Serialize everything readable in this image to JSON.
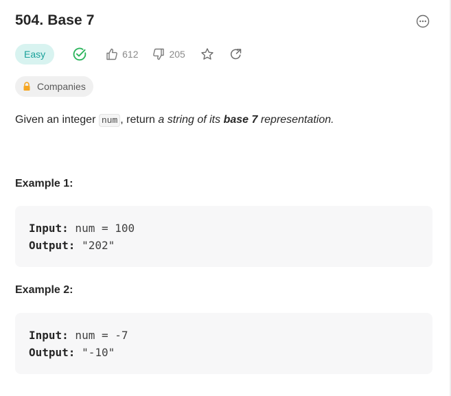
{
  "problem": {
    "title": "504. Base 7",
    "difficulty": "Easy",
    "likes": "612",
    "dislikes": "205",
    "companies_label": "Companies"
  },
  "description": {
    "part1": "Given an integer ",
    "code": "num",
    "part2": ", return ",
    "italic1": "a string of its ",
    "bold": "base 7",
    "italic2": " representation."
  },
  "examples": [
    {
      "title": "Example 1:",
      "input_label": "Input:",
      "input_value": " num = 100",
      "output_label": "Output:",
      "output_value": " \"202\""
    },
    {
      "title": "Example 2:",
      "input_label": "Input:",
      "input_value": " num = -7",
      "output_label": "Output:",
      "output_value": " \"-10\""
    }
  ],
  "colors": {
    "easy_text": "#1aa19a",
    "easy_bg": "#d8f3f0",
    "solved_green": "#2db55d",
    "lock_orange": "#f5a623"
  },
  "icons": {
    "more": "more-options-icon",
    "solved": "check-circle-icon",
    "like": "thumbs-up-icon",
    "dislike": "thumbs-down-icon",
    "favorite": "star-icon",
    "share": "share-icon",
    "lock": "lock-icon"
  }
}
